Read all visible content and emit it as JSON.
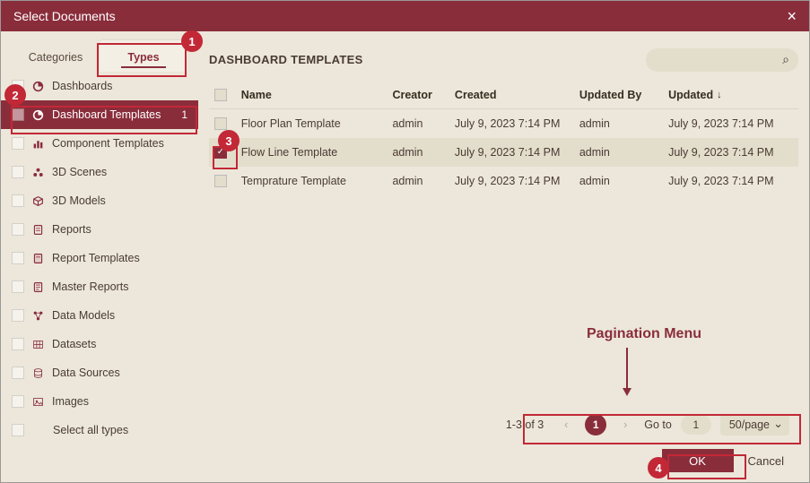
{
  "dialog": {
    "title": "Select Documents"
  },
  "tabs": {
    "categories": "Categories",
    "types": "Types"
  },
  "types": [
    {
      "name": "Dashboards",
      "icon": "pie"
    },
    {
      "name": "Dashboard Templates",
      "icon": "pie",
      "count": "1",
      "active": true
    },
    {
      "name": "Component Templates",
      "icon": "bars"
    },
    {
      "name": "3D Scenes",
      "icon": "cluster"
    },
    {
      "name": "3D Models",
      "icon": "cube"
    },
    {
      "name": "Reports",
      "icon": "doc"
    },
    {
      "name": "Report Templates",
      "icon": "doctpl"
    },
    {
      "name": "Master Reports",
      "icon": "docmaster"
    },
    {
      "name": "Data Models",
      "icon": "model"
    },
    {
      "name": "Datasets",
      "icon": "grid"
    },
    {
      "name": "Data Sources",
      "icon": "stack"
    },
    {
      "name": "Images",
      "icon": "image"
    },
    {
      "name": "Select all types",
      "icon": ""
    }
  ],
  "main": {
    "heading": "DASHBOARD TEMPLATES",
    "search_placeholder": ""
  },
  "columns": {
    "name": "Name",
    "creator": "Creator",
    "created": "Created",
    "updatedby": "Updated By",
    "updated": "Updated"
  },
  "rows": [
    {
      "checked": false,
      "name": "Floor Plan Template",
      "creator": "admin",
      "created": "July 9, 2023 7:14 PM",
      "updatedby": "admin",
      "updated": "July 9, 2023 7:14 PM"
    },
    {
      "checked": true,
      "name": "Flow Line Template",
      "creator": "admin",
      "created": "July 9, 2023 7:14 PM",
      "updatedby": "admin",
      "updated": "July 9, 2023 7:14 PM"
    },
    {
      "checked": false,
      "name": "Temprature Template",
      "creator": "admin",
      "created": "July 9, 2023 7:14 PM",
      "updatedby": "admin",
      "updated": "July 9, 2023 7:14 PM"
    }
  ],
  "pagination": {
    "info": "1-3 of 3",
    "current": "1",
    "goto_label": "Go to",
    "goto_value": "1",
    "page_size": "50/page",
    "annotation_label": "Pagination Menu"
  },
  "footer": {
    "ok": "OK",
    "cancel": "Cancel"
  },
  "annotations": {
    "c1": "1",
    "c2": "2",
    "c3": "3",
    "c4": "4"
  }
}
